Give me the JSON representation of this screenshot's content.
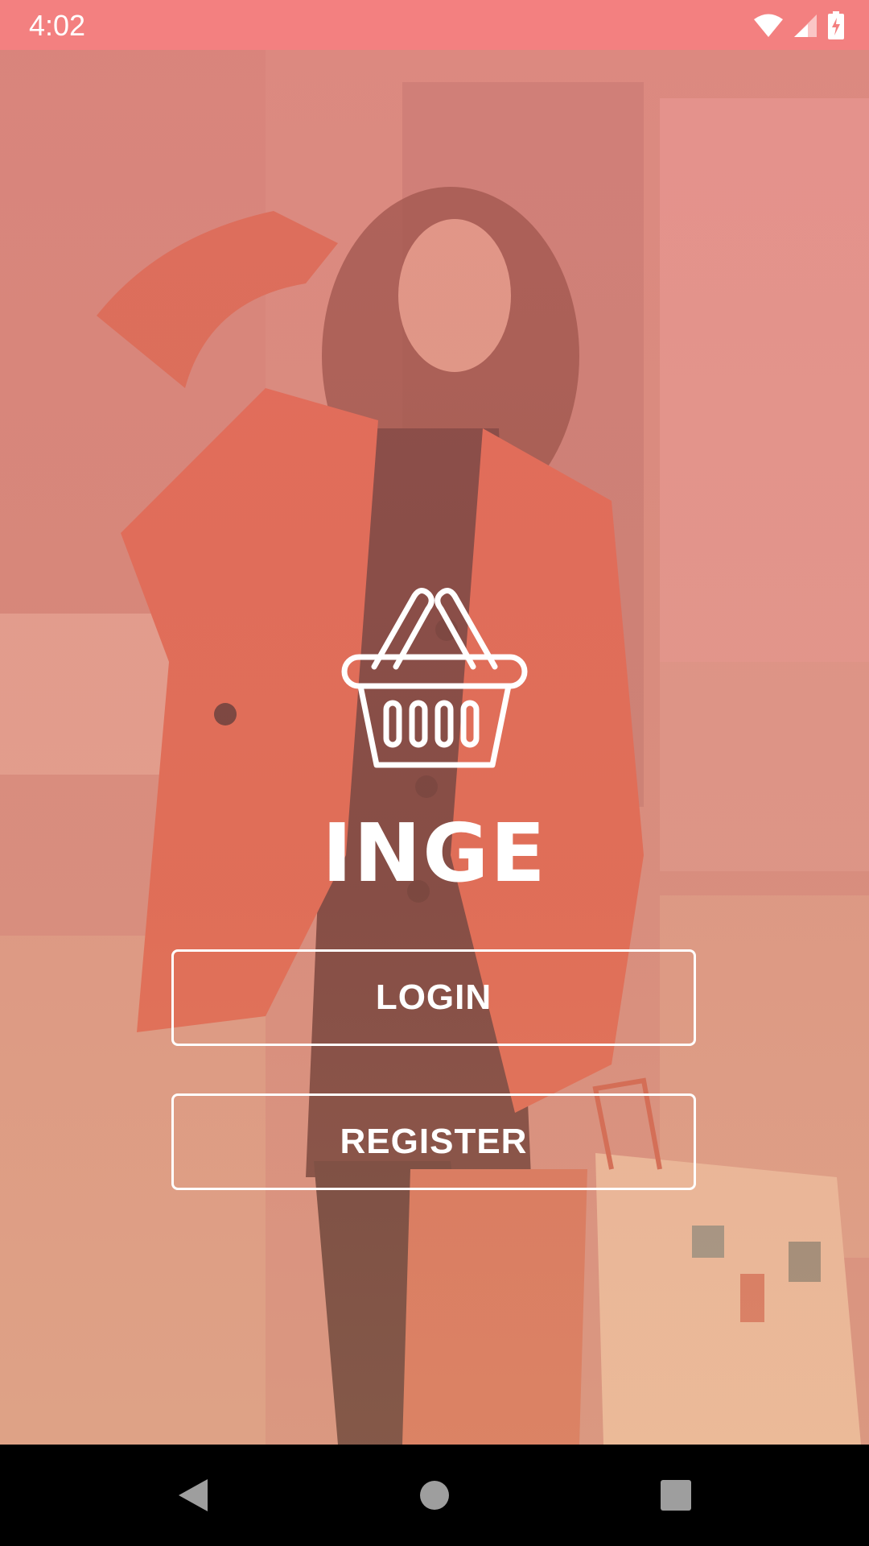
{
  "status_bar": {
    "time": "4:02",
    "icons": [
      "wifi-icon",
      "cellular-signal-icon",
      "battery-charging-icon"
    ],
    "background_color": "#f38080"
  },
  "brand": {
    "logo_icon": "shopping-basket-icon",
    "app_name": "INGE"
  },
  "buttons": {
    "login_label": "LOGIN",
    "register_label": "REGISTER"
  },
  "nav_bar": {
    "icons": [
      "back-icon",
      "home-icon",
      "recents-icon"
    ]
  },
  "colors": {
    "accent": "#f38080",
    "text": "#ffffff"
  }
}
